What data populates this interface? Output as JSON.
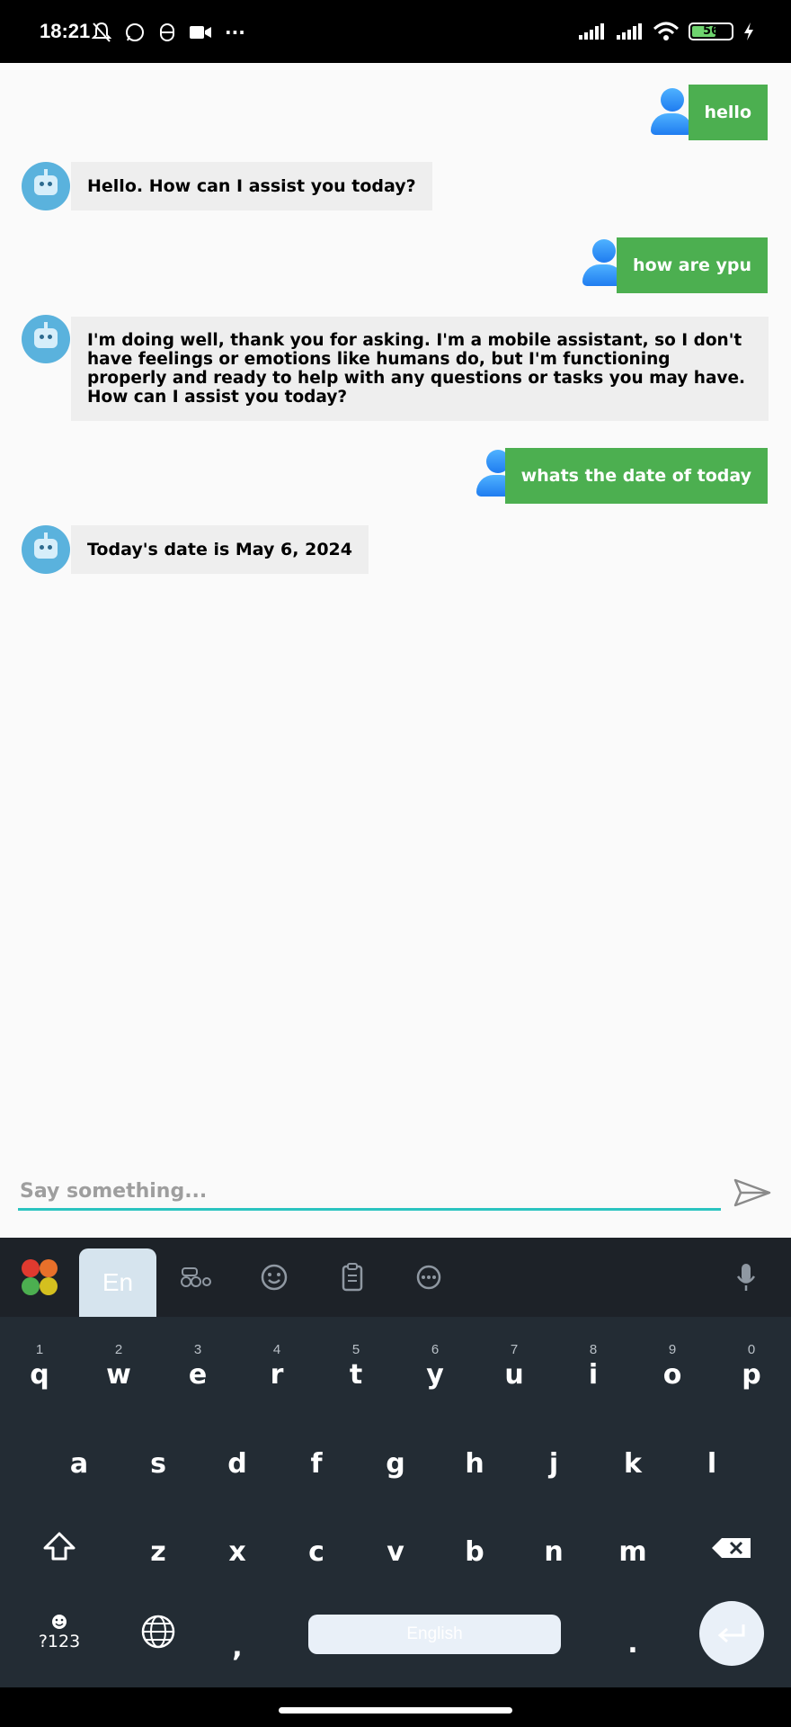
{
  "status_bar": {
    "time": "18:21",
    "battery_level": "56",
    "overflow": "···"
  },
  "messages": [
    {
      "sender": "user",
      "text": "hello"
    },
    {
      "sender": "bot",
      "text": "Hello. How can I assist you today?"
    },
    {
      "sender": "user",
      "text": "how are ypu"
    },
    {
      "sender": "bot",
      "text": "I'm doing well, thank you for asking. I'm a mobile assistant, so I don't have feelings or emotions like humans do, but I'm functioning properly and ready to help with any questions or tasks you may have. How can I assist you today?"
    },
    {
      "sender": "user",
      "text": "whats the date of today"
    },
    {
      "sender": "bot",
      "text": "Today's date is May 6, 2024"
    }
  ],
  "input": {
    "placeholder": "Say something...",
    "send_icon": "send-icon"
  },
  "keyboard": {
    "language_tab": "En",
    "toolbar_icons": [
      "apps-icon",
      "incognito-icon",
      "emoji-icon",
      "clipboard-icon",
      "more-icon",
      "mic-icon"
    ],
    "row1": [
      {
        "hint": "1",
        "key": "q"
      },
      {
        "hint": "2",
        "key": "w"
      },
      {
        "hint": "3",
        "key": "e"
      },
      {
        "hint": "4",
        "key": "r"
      },
      {
        "hint": "5",
        "key": "t"
      },
      {
        "hint": "6",
        "key": "y"
      },
      {
        "hint": "7",
        "key": "u"
      },
      {
        "hint": "8",
        "key": "i"
      },
      {
        "hint": "9",
        "key": "o"
      },
      {
        "hint": "0",
        "key": "p"
      }
    ],
    "row2": [
      "a",
      "s",
      "d",
      "f",
      "g",
      "h",
      "j",
      "k",
      "l"
    ],
    "row3": [
      "z",
      "x",
      "c",
      "v",
      "b",
      "n",
      "m"
    ],
    "symbols_label": "?123",
    "comma": ",",
    "space_label": "English",
    "period": ".",
    "shift_icon": "shift-icon",
    "backspace_icon": "backspace-icon",
    "globe_icon": "globe-icon",
    "enter_icon": "enter-icon"
  },
  "colors": {
    "user_bubble": "#4caf50",
    "bot_bubble": "#eeeeee",
    "input_underline": "#2bc4c0",
    "keyboard_bg": "#232c34"
  }
}
